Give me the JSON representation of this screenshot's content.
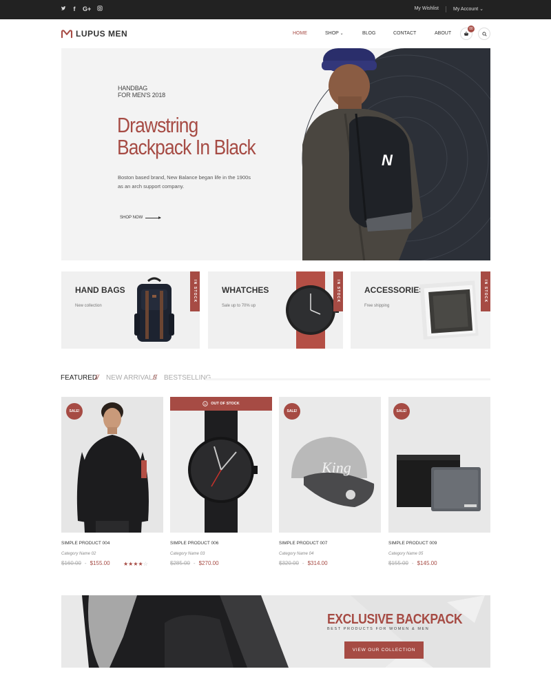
{
  "colors": {
    "accent": "#a64b44",
    "topbar": "#222222",
    "hero_bg": "#f3f3f3",
    "dark_panel": "#2c3038"
  },
  "topbar": {
    "social": [
      {
        "icon": "twitter-icon",
        "glyph": "🐦"
      },
      {
        "icon": "facebook-icon",
        "glyph": "f"
      },
      {
        "icon": "google-plus-icon",
        "glyph": "G+"
      },
      {
        "icon": "instagram-icon",
        "glyph": "◎"
      }
    ],
    "wishlist": "My Wishlist",
    "account": "My Account"
  },
  "header": {
    "logo_text": "LUPUS MEN",
    "nav": [
      "HOME",
      "SHOP",
      "BLOG",
      "CONTACT",
      "ABOUT"
    ],
    "active_nav": "HOME",
    "cart_count": "00"
  },
  "hero": {
    "eyebrow": "HANDBAG\nFOR MEN'S 2018",
    "title": "Drawstring\nBackpack In Black",
    "description": "Boston based brand, New Balance began life in the 1900s\nas an arch support company.",
    "cta": "SHOP NOW"
  },
  "categories": [
    {
      "title": "HAND BAGS",
      "subtitle": "New collection",
      "ribbon": "IN STOCK"
    },
    {
      "title": "WHATCHES",
      "subtitle": "Sale up to 70% up",
      "ribbon": "IN STOCK"
    },
    {
      "title": "ACCESSORIES",
      "subtitle": "Free shipping",
      "ribbon": "IN STOCK"
    }
  ],
  "tabs": {
    "items": [
      "FEATURED",
      "NEW ARRIVALS",
      "BESTSELLING"
    ],
    "active": "FEATURED",
    "separator": "//"
  },
  "products": [
    {
      "name": "SIMPLE PRODUCT 004",
      "category": "Category Name 02",
      "old_price": "$160.00",
      "price": "$155.00",
      "badge": "SALE!",
      "rating": 4
    },
    {
      "name": "SIMPLE PRODUCT 006",
      "category": "Category Name 03",
      "old_price": "$285.00",
      "price": "$270.00",
      "badge": "OUT OF STOCK"
    },
    {
      "name": "SIMPLE PRODUCT 007",
      "category": "Category Name 04",
      "old_price": "$320.00",
      "price": "$314.00",
      "badge": "SALE!"
    },
    {
      "name": "SIMPLE PRODUCT 009",
      "category": "Category Name 05",
      "old_price": "$155.00",
      "price": "$145.00",
      "badge": "SALE!"
    }
  ],
  "banner": {
    "title": "EXCLUSIVE BACKPACK",
    "subtitle": "BEST PRODUCTS FOR WOMEN & MEN",
    "button": "VIEW OUR COLLECTION"
  }
}
